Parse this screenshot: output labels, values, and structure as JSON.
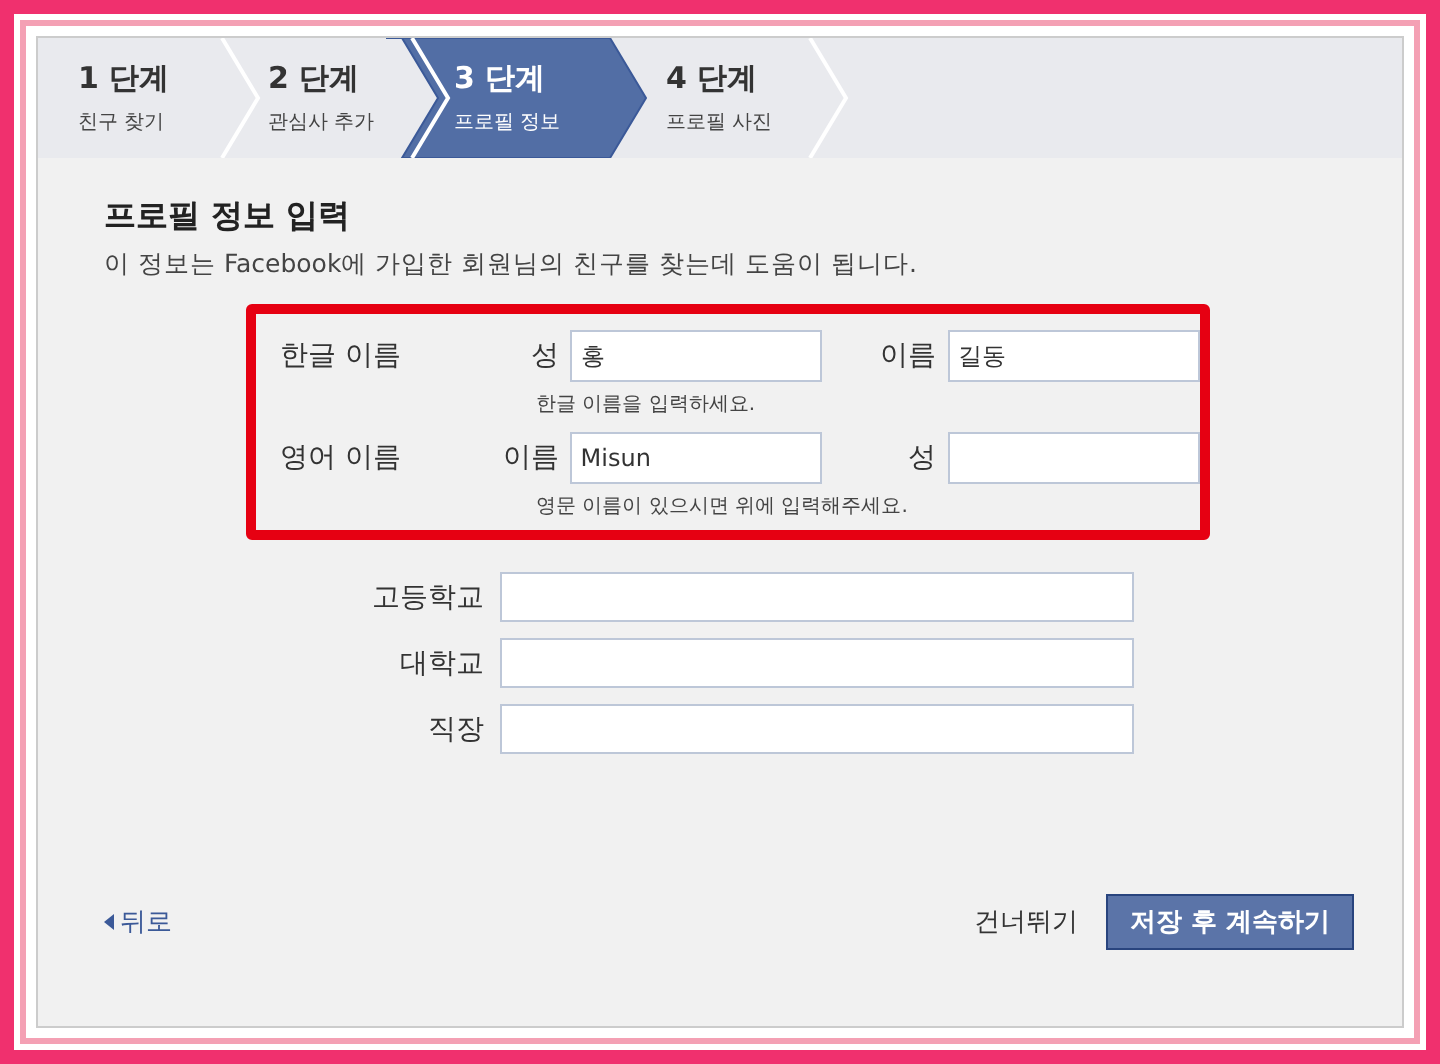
{
  "steps": [
    {
      "number": "1 단계",
      "label": "친구 찾기",
      "selected": false
    },
    {
      "number": "2 단계",
      "label": "관심사 추가",
      "selected": false
    },
    {
      "number": "3 단계",
      "label": "프로필 정보",
      "selected": true
    },
    {
      "number": "4 단계",
      "label": "프로필 사진",
      "selected": false
    }
  ],
  "heading": "프로필 정보 입력",
  "description": "이 정보는 Facebook에 가입한 회원님의 친구를 찾는데 도움이 됩니다.",
  "name_rows": [
    {
      "label": "한글 이름",
      "field_1": {
        "label": "성",
        "value": "홍"
      },
      "field_2": {
        "label": "이름",
        "value": "길동"
      },
      "hint": "한글 이름을 입력하세요."
    },
    {
      "label": "영어 이름",
      "field_1": {
        "label": "이름",
        "value": "Misun"
      },
      "field_2": {
        "label": "성"
      },
      "hint": "영문 이름이 있으시면 위에 입력해주세요."
    }
  ],
  "fields": [
    {
      "label": "고등학교"
    },
    {
      "label": "대학교"
    },
    {
      "label": "직장"
    }
  ],
  "back_link": "뒤로",
  "skip_link": "건너뛰기",
  "save_button": "저장 후 계속하기"
}
